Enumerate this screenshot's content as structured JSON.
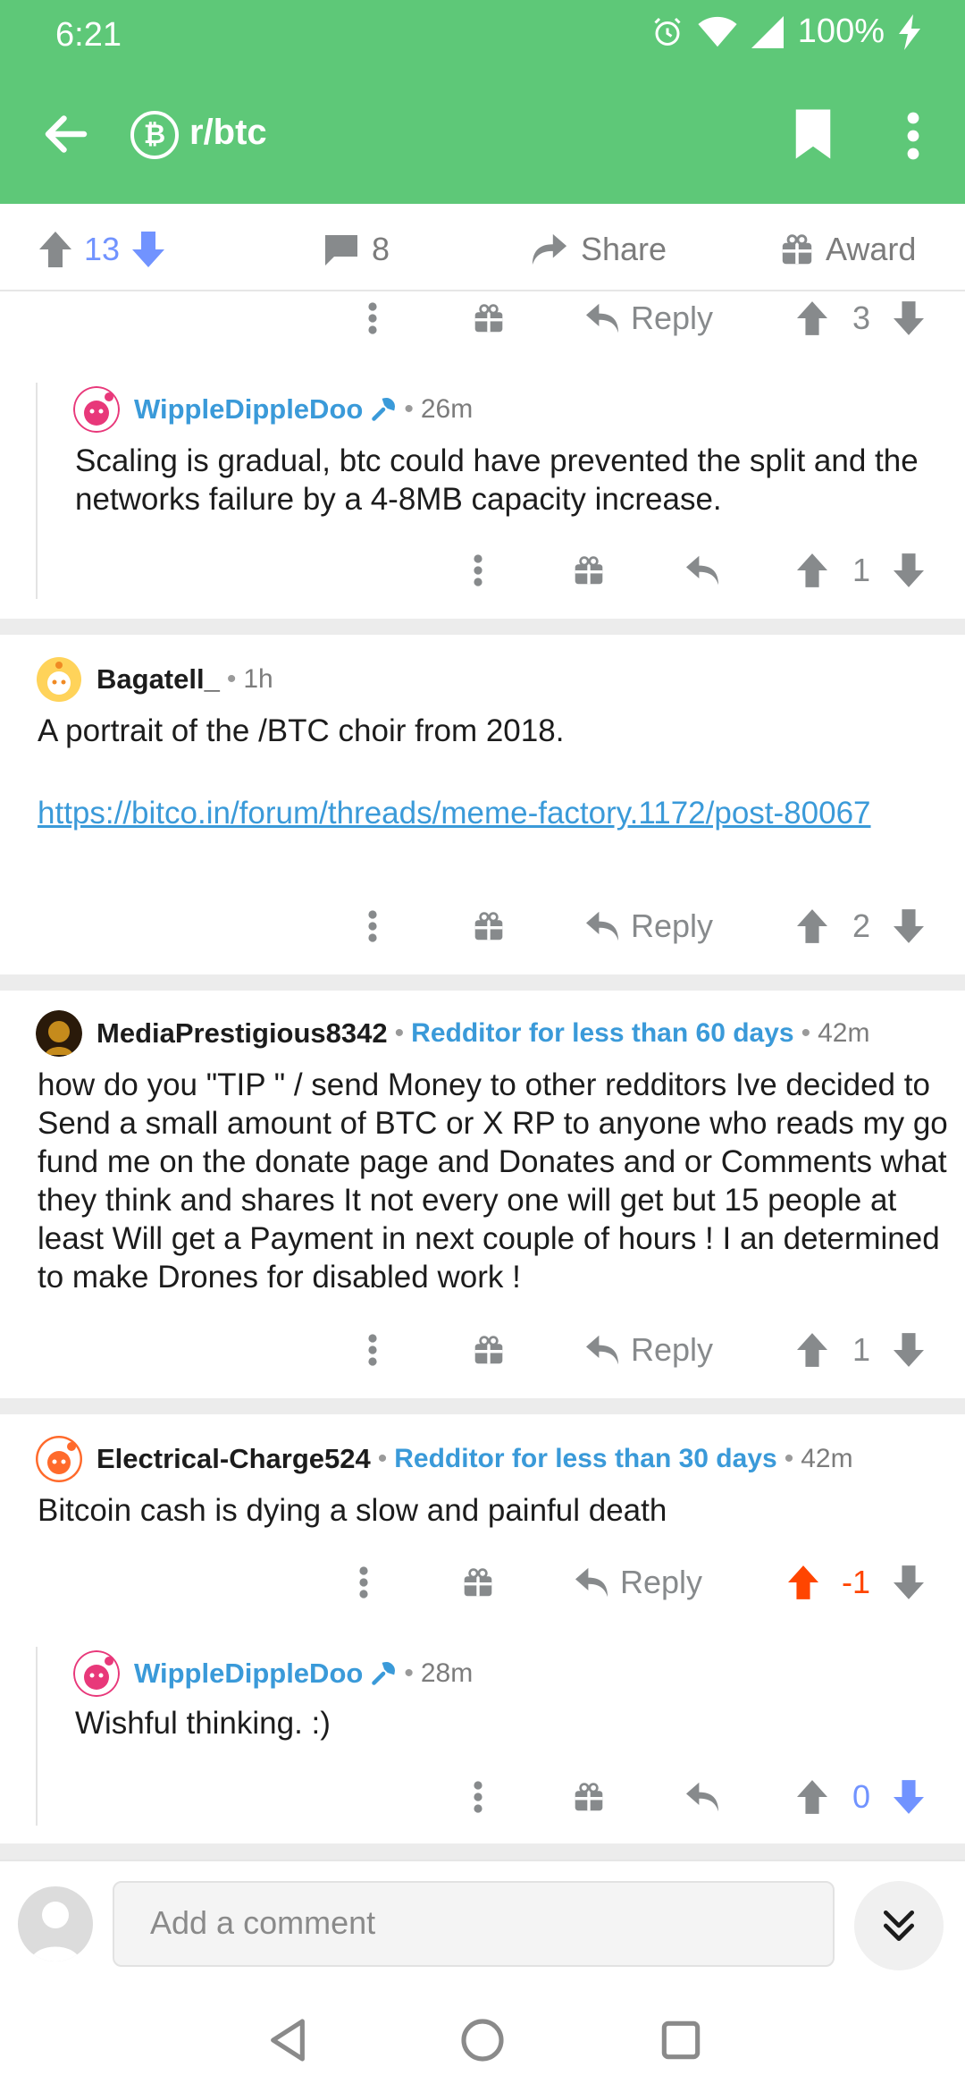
{
  "status": {
    "time": "6:21",
    "battery": "100%",
    "icons": [
      "alarm-icon",
      "wifi-icon",
      "signal-icon",
      "charging-icon"
    ]
  },
  "appbar": {
    "title": "r/btc",
    "subreddit_icon_glyph": "₿"
  },
  "post_actions": {
    "upvotes": "13",
    "comments": "8",
    "share_label": "Share",
    "award_label": "Award"
  },
  "comments": [
    {
      "reply_label": "Reply",
      "score": "3"
    },
    {
      "user": "WippleDippleDoo",
      "time": "26m",
      "body": "Scaling is gradual, btc could have prevented the split and the networks failure by a 4-8MB capacity increase.",
      "score": "1"
    },
    {
      "user": "Bagatell_",
      "time": "1h",
      "body": "A portrait of the /BTC choir from 2018.",
      "link": "https://bitco.in/forum/threads/meme-factory.1172/post-80067",
      "reply_label": "Reply",
      "score": "2"
    },
    {
      "user": "MediaPrestigious8342",
      "flair": "Redditor for less than 60 days",
      "time": "42m",
      "body": "how do you \"TIP \" / send Money to other redditors Ive decided to Send a small amount of BTC or X RP to anyone who reads my go fund me on the donate page and Donates and or Comments what they think and shares It not every one will get but 15 people at least Will get a Payment in next couple of hours ! I an determined to make Drones for disabled work !",
      "reply_label": "Reply",
      "score": "1"
    },
    {
      "user": "Electrical-Charge524",
      "flair": "Redditor for less than 30 days",
      "time": "42m",
      "body": "Bitcoin cash is dying a slow and painful death",
      "reply_label": "Reply",
      "score": "-1"
    },
    {
      "user": "WippleDippleDoo",
      "time": "28m",
      "body": "Wishful thinking. :)",
      "score": "0"
    }
  ],
  "composer": {
    "placeholder": "Add a comment"
  },
  "colors": {
    "header": "#5ec878",
    "op_blue": "#3a9ad9",
    "upvote_orange": "#ff4500",
    "downvote_blue": "#7193ff"
  }
}
